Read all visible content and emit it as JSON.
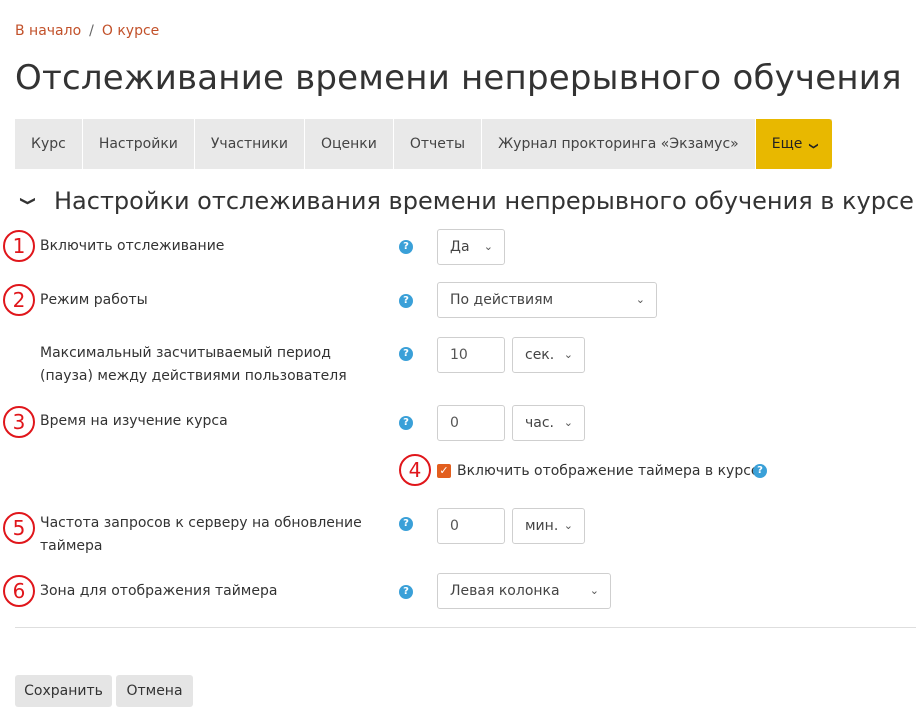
{
  "breadcrumb": {
    "home": "В начало",
    "separator": "/",
    "current": "О курсе"
  },
  "page_title": "Отслеживание времени непрерывного обучения",
  "tabs": [
    {
      "label": "Курс"
    },
    {
      "label": "Настройки"
    },
    {
      "label": "Участники"
    },
    {
      "label": "Оценки"
    },
    {
      "label": "Отчеты"
    },
    {
      "label": "Журнал прокторинга «Экзамус»"
    },
    {
      "label": "Еще",
      "caret": "❯"
    }
  ],
  "section": {
    "chevron": "❯",
    "title": "Настройки отслеживания времени непрерывного обучения в курсе"
  },
  "help_glyph": "?",
  "markers": [
    "1",
    "2",
    "3",
    "4",
    "5",
    "6"
  ],
  "fields": {
    "enable_tracking": {
      "label": "Включить отслеживание",
      "value": "Да"
    },
    "mode": {
      "label": "Режим работы",
      "value": "По действиям"
    },
    "max_period": {
      "label": "Максимальный засчитываемый период (пауза) между действиями пользователя",
      "value": "10",
      "unit": "сек."
    },
    "study_time": {
      "label": "Время на изучение курса",
      "value": "0",
      "unit": "час."
    },
    "show_timer": {
      "label": "Включить отображение таймера в курсе",
      "checked": true,
      "check_glyph": "✓"
    },
    "request_frequency": {
      "label": "Частота запросов к серверу на обновление таймера",
      "value": "0",
      "unit": "мин."
    },
    "timer_zone": {
      "label": "Зона для отображения таймера",
      "value": "Левая колонка"
    }
  },
  "select_arrow": "⌄",
  "buttons": {
    "save": "Сохранить",
    "cancel": "Отмена"
  },
  "colors": {
    "accent_link": "#c2512a",
    "more_tab": "#e8b800",
    "help_icon": "#3aa0d8",
    "checkbox": "#e25e1e",
    "marker": "#e0161b"
  }
}
